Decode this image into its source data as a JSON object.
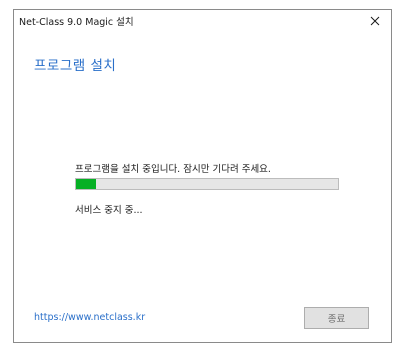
{
  "window": {
    "title": "Net-Class 9.0 Magic 설치",
    "close_icon": "close-icon"
  },
  "main": {
    "heading": "프로그램 설치",
    "status_text": "프로그램을 설치 중입니다. 잠시만 기다려 주세요.",
    "progress": 0.075,
    "substatus_text": "서비스 중지 중..."
  },
  "footer": {
    "link_text": "https://www.netclass.kr",
    "finish_label": "종료"
  },
  "colors": {
    "accent": "#2a6fc9",
    "progress_fill": "#06b025",
    "progress_track": "#e6e6e6"
  }
}
